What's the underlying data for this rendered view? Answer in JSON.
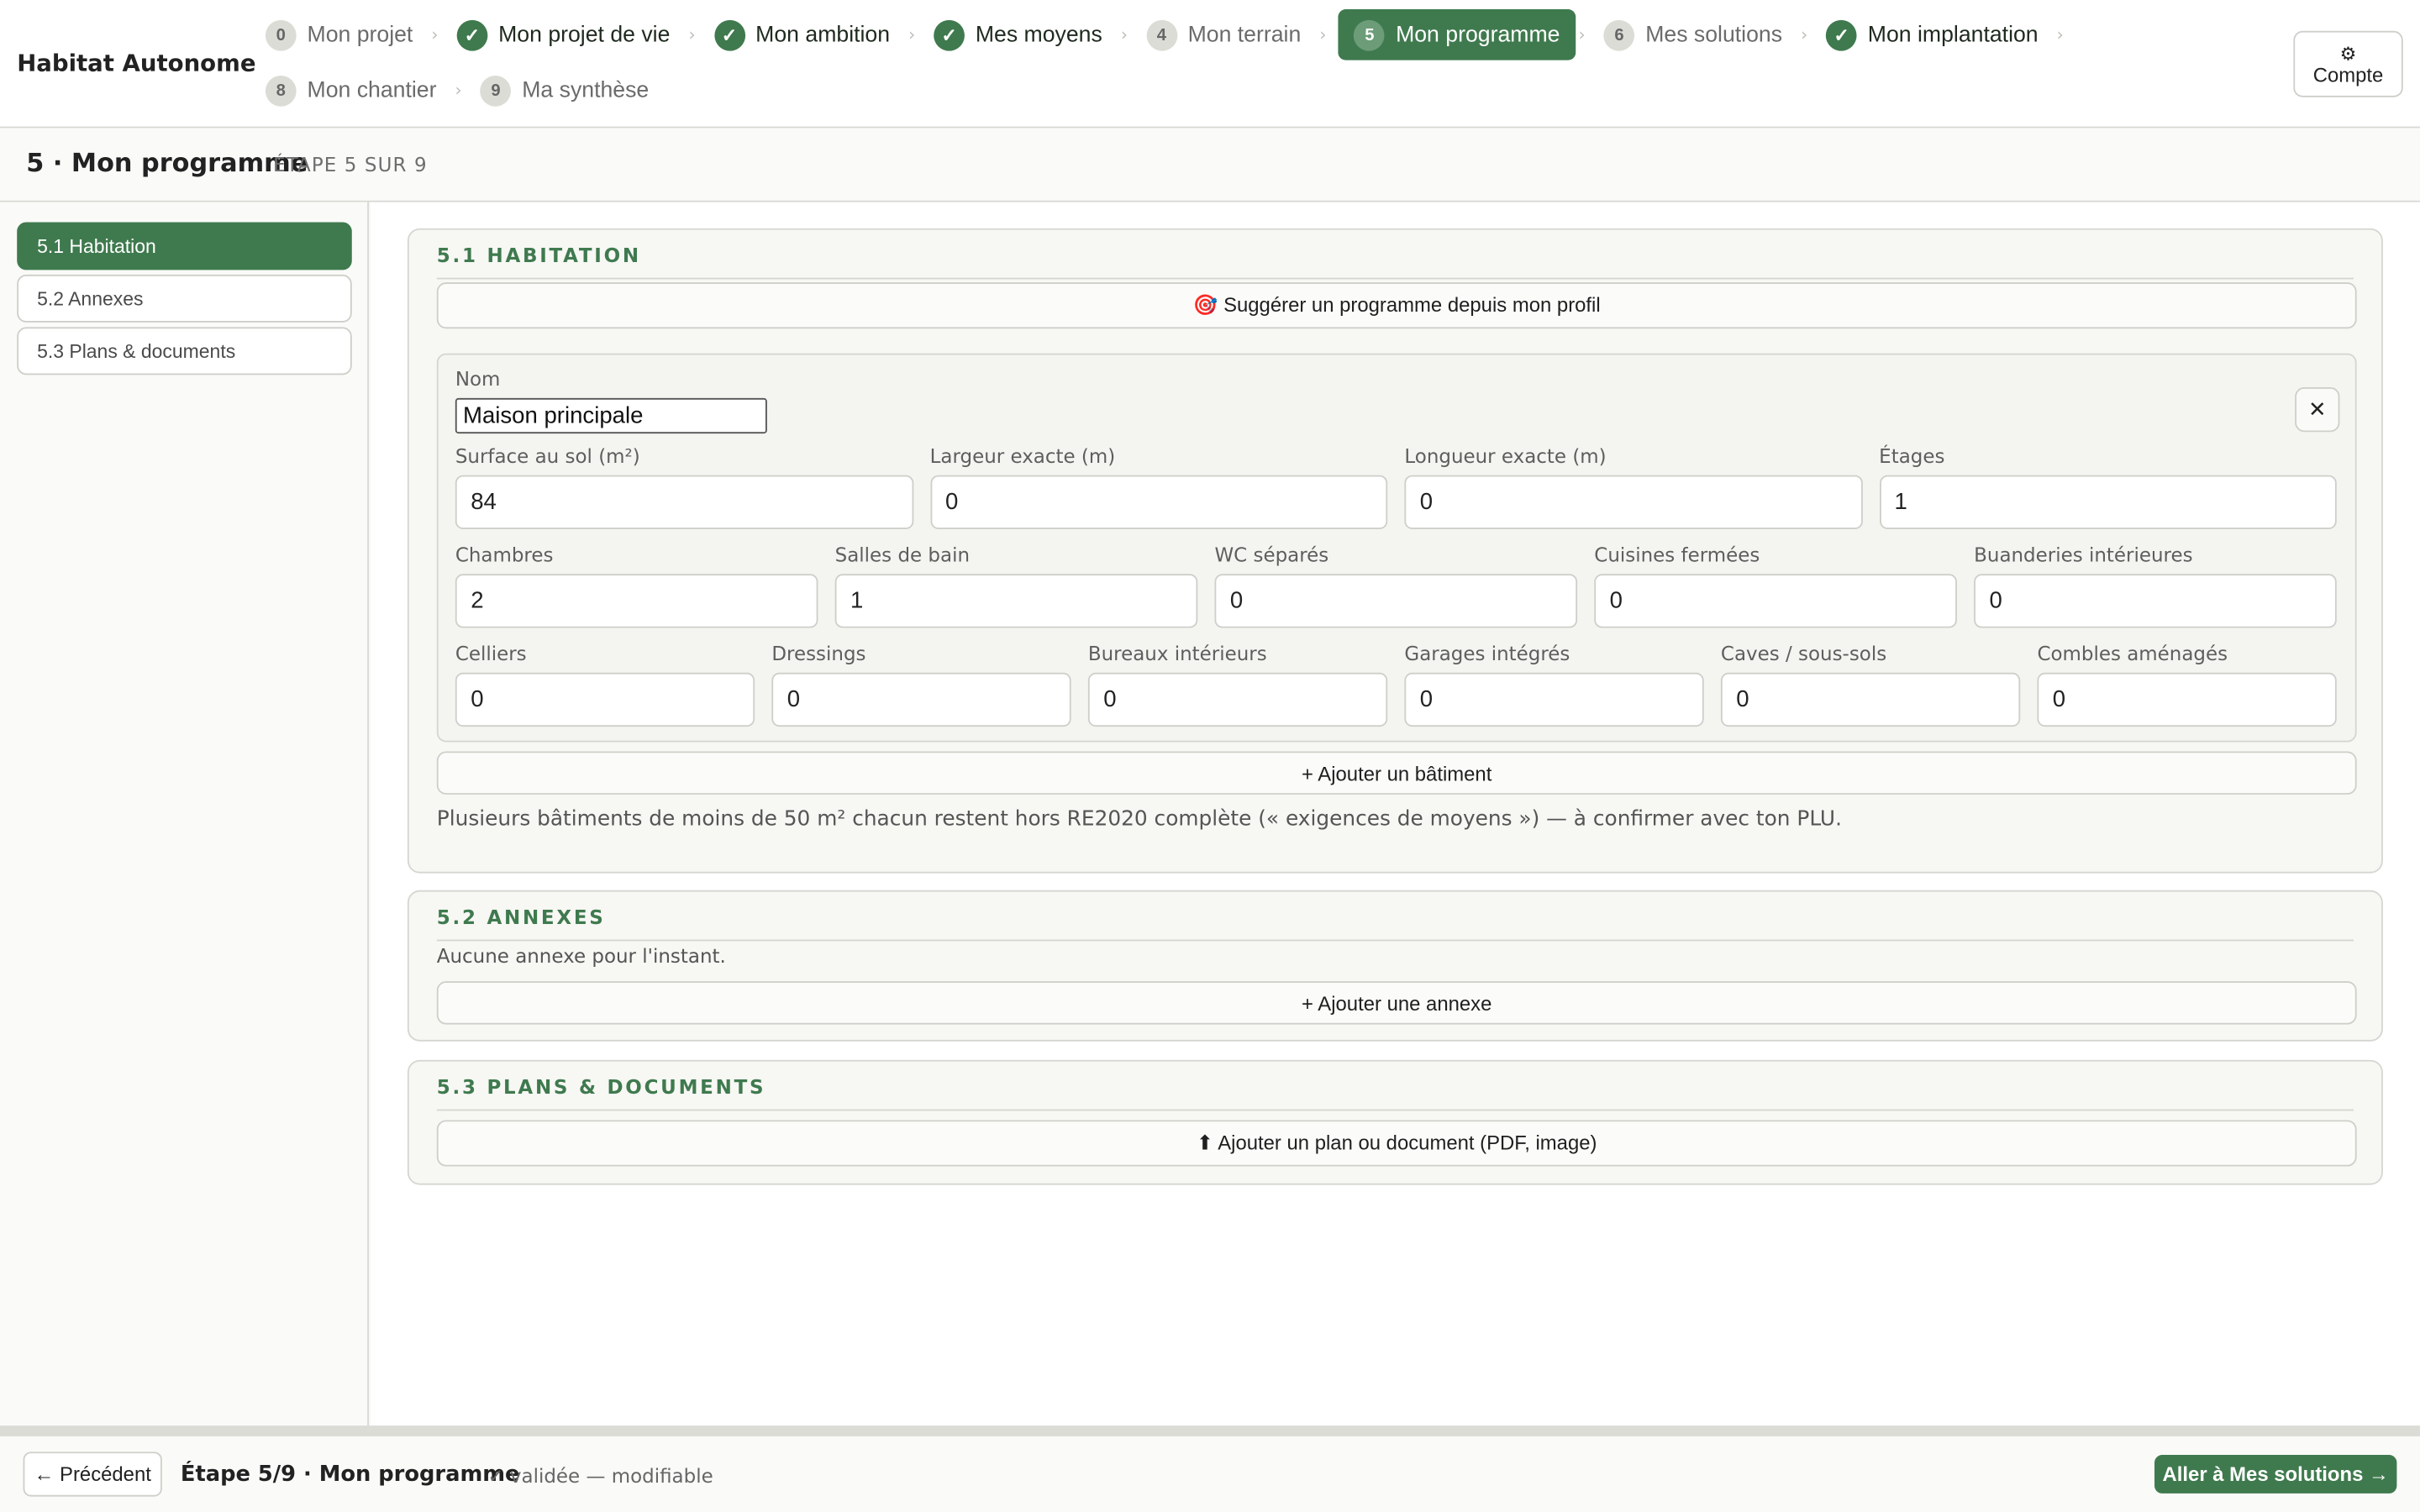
{
  "app": {
    "title": "Habitat Autonome",
    "account_icon": "⚙",
    "account_label": "Compte"
  },
  "steps": [
    {
      "num": "0",
      "label": "Mon projet",
      "state": "todo"
    },
    {
      "num": "✓",
      "label": "Mon projet de vie",
      "state": "done"
    },
    {
      "num": "✓",
      "label": "Mon ambition",
      "state": "done"
    },
    {
      "num": "✓",
      "label": "Mes moyens",
      "state": "done"
    },
    {
      "num": "4",
      "label": "Mon terrain",
      "state": "todo"
    },
    {
      "num": "5",
      "label": "Mon programme",
      "state": "active"
    },
    {
      "num": "6",
      "label": "Mes solutions",
      "state": "todo"
    },
    {
      "num": "✓",
      "label": "Mon implantation",
      "state": "done"
    },
    {
      "num": "8",
      "label": "Mon chantier",
      "state": "todo"
    },
    {
      "num": "9",
      "label": "Ma synthèse",
      "state": "todo"
    }
  ],
  "page": {
    "title": "5 · Mon programme",
    "substep": "ÉTAPE 5 SUR 9"
  },
  "sidebar": {
    "items": [
      {
        "label": "5.1 Habitation",
        "active": true
      },
      {
        "label": "5.2 Annexes",
        "active": false
      },
      {
        "label": "5.3 Plans & documents",
        "active": false
      }
    ]
  },
  "habitation": {
    "title": "5.1 HABITATION",
    "suggest_button": "🎯 Suggérer un programme depuis mon profil",
    "name_label": "Nom",
    "name_value": "Maison principale",
    "close_icon": "✕",
    "row1": [
      {
        "label": "Surface au sol (m²)",
        "value": "84"
      },
      {
        "label": "Largeur exacte (m)",
        "value": "0"
      },
      {
        "label": "Longueur exacte (m)",
        "value": "0"
      },
      {
        "label": "Étages",
        "value": "1"
      }
    ],
    "row2": [
      {
        "label": "Chambres",
        "value": "2"
      },
      {
        "label": "Salles de bain",
        "value": "1"
      },
      {
        "label": "WC séparés",
        "value": "0"
      },
      {
        "label": "Cuisines fermées",
        "value": "0"
      },
      {
        "label": "Buanderies intérieures",
        "value": "0"
      }
    ],
    "row3": [
      {
        "label": "Celliers",
        "value": "0"
      },
      {
        "label": "Dressings",
        "value": "0"
      },
      {
        "label": "Bureaux intérieurs",
        "value": "0"
      },
      {
        "label": "Garages intégrés",
        "value": "0"
      },
      {
        "label": "Caves / sous-sols",
        "value": "0"
      },
      {
        "label": "Combles aménagés",
        "value": "0"
      }
    ],
    "add_building": "+ Ajouter un bâtiment",
    "note": "Plusieurs bâtiments de moins de 50 m² chacun restent hors RE2020 complète (« exigences de moyens ») — à confirmer avec ton PLU."
  },
  "annexes": {
    "title": "5.2 ANNEXES",
    "empty": "Aucune annexe pour l'instant.",
    "add_button": "+ Ajouter une annexe"
  },
  "plans": {
    "title": "5.3 PLANS & DOCUMENTS",
    "upload_button": "⬆ Ajouter un plan ou document (PDF, image)"
  },
  "footer": {
    "prev": "← Précédent",
    "step": "Étape 5/9 · Mon programme",
    "status": "✓ validée — modifiable",
    "next": "Aller à Mes solutions →"
  },
  "colors": {
    "accent": "#3f7a4e"
  }
}
